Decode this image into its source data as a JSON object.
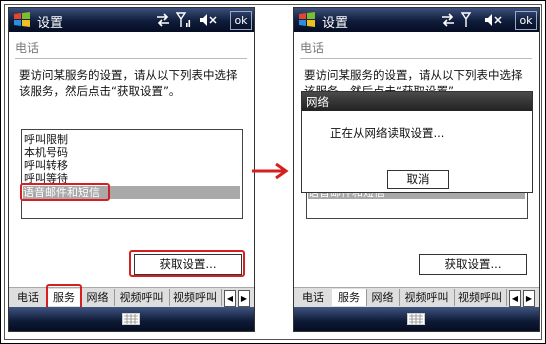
{
  "titlebar": {
    "title": "设置",
    "ok_label": "ok"
  },
  "page": {
    "section_title": "电话",
    "description": "要访问某服务的设置，请从以下列表中选择该服务，然后点击“获取设置”。"
  },
  "services_list": {
    "items": [
      "呼叫限制",
      "本机号码",
      "呼叫转移",
      "呼叫等待",
      "语音邮件和短信"
    ],
    "selected_index": 4
  },
  "buttons": {
    "get_settings": "获取设置..."
  },
  "tabs": [
    "电话",
    "服务",
    "网络",
    "视频呼叫",
    "视频呼叫"
  ],
  "active_tab_index": 1,
  "dialog": {
    "title": "网络",
    "message": "正在从网络读取设置...",
    "cancel": "取消"
  },
  "colors": {
    "titlebar": "#0f1c3a",
    "highlight": "#d42020",
    "selection": "#a9a9a9"
  },
  "icons": [
    "windows-logo-icon",
    "connectivity-icon",
    "signal-icon",
    "speaker-icon",
    "keyboard-icon",
    "arrow-right-icon"
  ]
}
